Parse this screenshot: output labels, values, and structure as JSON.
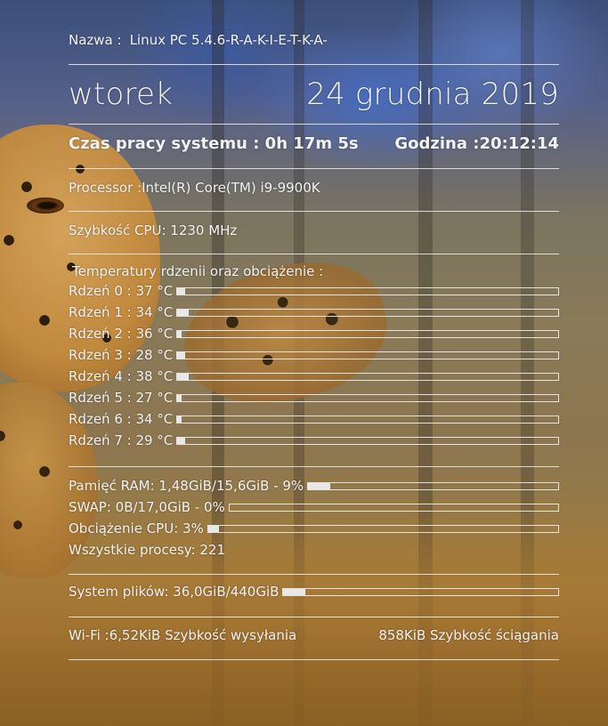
{
  "system": {
    "name_label": "Nazwa :",
    "name_value": "Linux PC 5.4.6-R-A-K-I-E-T-K-A-",
    "day": "wtorek",
    "date": "24 grudnia 2019",
    "uptime": "Czas pracy systemu : 0h 17m 5s",
    "clock": "Godzina :20:12:14",
    "processor": "Processor :Intel(R) Core(TM) i9-9900K",
    "cpu_speed": "Szybkość CPU: 1230 MHz"
  },
  "temperatures": {
    "title": "Temperatury rdzenii oraz obciążenie :",
    "cores": [
      {
        "label": "Rdzeń 0 : 37 °C",
        "load_percent": 2
      },
      {
        "label": "Rdzeń 1 : 34 °C",
        "load_percent": 3
      },
      {
        "label": "Rdzeń 2 : 36 °C",
        "load_percent": 1
      },
      {
        "label": "Rdzeń 3 : 28 °C",
        "load_percent": 2
      },
      {
        "label": "Rdzeń 4 : 38 °C",
        "load_percent": 3
      },
      {
        "label": "Rdzeń 5 : 27 °C",
        "load_percent": 1
      },
      {
        "label": "Rdzeń 6 : 34 °C",
        "load_percent": 1
      },
      {
        "label": "Rdzeń 7 : 29 °C",
        "load_percent": 2
      }
    ]
  },
  "memory": {
    "ram": {
      "label": "Pamięć RAM: 1,48GiB/15,6GiB - 9%",
      "percent": 9
    },
    "swap": {
      "label": "SWAP: 0B/17,0GiB - 0%",
      "percent": 0
    },
    "cpu_load": {
      "label": "Obciążenie CPU: 3%",
      "percent": 3
    },
    "processes": "Wszystkie procesy: 221"
  },
  "filesystem": {
    "label": "System plików: 36,0GiB/440GiB",
    "percent": 8
  },
  "network": {
    "upload": "Wi-Fi :6,52KiB Szybkość wysyłania",
    "download": "858KiB Szybkość ściągania"
  }
}
